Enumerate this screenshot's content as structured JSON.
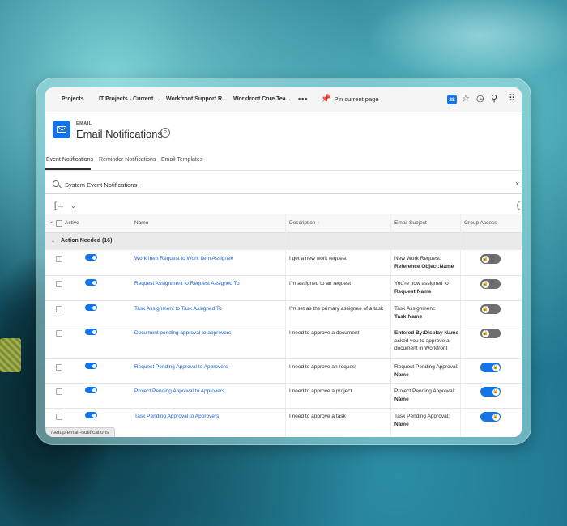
{
  "topnav": {
    "tabs": [
      "Projects",
      "IT Projects - Current ...",
      "Workfront Support R...",
      "Workfront Core Tea..."
    ],
    "more": "•••",
    "pin_label": "Pin current page",
    "badge": "28"
  },
  "header": {
    "kicker": "EMAIL",
    "title": "Email Notifications",
    "help": "?"
  },
  "subtabs": [
    "Event Notifications",
    "Reminder Notifications",
    "Email Templates"
  ],
  "search": {
    "value": "System Event Notifications",
    "clear": "×"
  },
  "table": {
    "columns": {
      "active": "Active",
      "name": "Name",
      "description": "Description ↑",
      "subject": "Email Subject",
      "group": "Group Access"
    },
    "group_label": "Action Needed (16)",
    "rows": [
      {
        "name": "Work Item Request to Work Item Assignee",
        "description": "I get a new work request",
        "subject_a": "New Work Request:",
        "subject_b": "Reference Object:Name",
        "group_access": false
      },
      {
        "name": "Request Assignment to Request Assigned To",
        "description": "I'm assigned to an request",
        "subject_a": "You're now assigned to",
        "subject_b": "Request:Name",
        "group_access": false
      },
      {
        "name": "Task Assignment to Task Assigned To",
        "description": "I'm set as the primary assignee of a task",
        "subject_a": "Task Assignment:",
        "subject_b": "Task:Name",
        "group_access": false
      },
      {
        "name": "Document pending approval to approvers",
        "description": "I need to approve a document",
        "subject_a": "Entered By:Display Name",
        "subject_b": "asked you to approve a document in Workfront",
        "group_access": false
      },
      {
        "name": "Request Pending Approval to Approvers",
        "description": "I need to approve an request",
        "subject_a": "Request Pending Approval:",
        "subject_b": "Name",
        "group_access": true
      },
      {
        "name": "Project Pending Approval to Approvers",
        "description": "I need to approve a project",
        "subject_a": "Project Pending Approval:",
        "subject_b": "Name",
        "group_access": true
      },
      {
        "name": "Task Pending Approval to Approvers",
        "description": "I need to approve a task",
        "subject_a": "Task Pending Approval:",
        "subject_b": "Name",
        "group_access": true
      }
    ]
  },
  "status_url": "/setup/email-notifications",
  "colors": {
    "accent": "#1473e6",
    "link": "#1b5fc7",
    "toggle_off": "#6e6e6e"
  }
}
